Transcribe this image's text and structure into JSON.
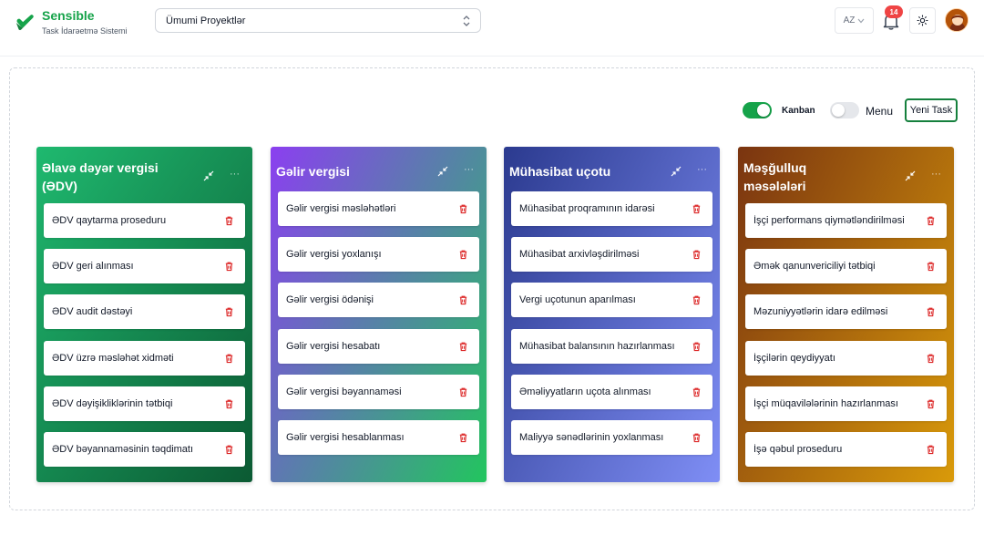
{
  "app": {
    "name": "Sensible",
    "subtitle": "Task İdarəetmə Sistemi"
  },
  "header": {
    "project_select": "Ümumi Proyektlər",
    "language": "AZ",
    "notifications_count": "14",
    "icons": {
      "logo": "check-heart-icon",
      "bell": "bell-icon",
      "theme": "sun-icon",
      "chevron": "chevron-up-down-icon",
      "user": "avatar"
    }
  },
  "toolbar": {
    "kanban_label": "Kanban",
    "kanban_on": true,
    "menu_label": "Menu",
    "menu_on": false,
    "new_task_label": "Yeni Task"
  },
  "columns": [
    {
      "title": "Əlavə dəyər vergisi (ƏDV)",
      "title_lines": [
        "Əlavə dəyər vergisi",
        "(ƏDV)"
      ],
      "colors": {
        "from": "#1fb96f",
        "to": "#0b5a33"
      },
      "cards": [
        "ƏDV qaytarma proseduru",
        "ƏDV geri alınması",
        "ƏDV audit dəstəyi",
        "ƏDV üzrə məsləhət xidməti",
        "ƏDV dəyişikliklərinin tətbiqi",
        "ƏDV bəyannaməsinin təqdimatı"
      ]
    },
    {
      "title": "Gəlir vergisi",
      "title_lines": [
        "Gəlir vergisi"
      ],
      "colors": {
        "from": "#8b3ff0",
        "to": "#22c55e"
      },
      "cards": [
        "Gəlir vergisi məsləhətləri",
        "Gəlir vergisi yoxlanışı",
        "Gəlir vergisi ödənişi",
        "Gəlir vergisi hesabatı",
        "Gəlir vergisi bəyannaməsi",
        "Gəlir vergisi hesablanması"
      ]
    },
    {
      "title": "Mühasibat uçotu",
      "title_lines": [
        "Mühasibat uçotu"
      ],
      "colors": {
        "from": "#2b3a8f",
        "to": "#7f8ef5"
      },
      "cards": [
        "Mühasibat proqramının idarəsi",
        "Mühasibat arxivləşdirilməsi",
        "Vergi uçotunun aparılması",
        "Mühasibat balansının hazırlanması",
        "Əməliyyatların uçota alınması",
        "Maliyyə sənədlərinin yoxlanması"
      ]
    },
    {
      "title": "Məşğulluq məsələləri",
      "title_lines": [
        "Məşğulluq",
        "məsələləri"
      ],
      "colors": {
        "from": "#7a3410",
        "to": "#d99a0a"
      },
      "cards": [
        "İşçi performans qiymətləndirilməsi",
        "Əmək qanunvericiliyi tətbiqi",
        "Məzuniyyətlərin idarə edilməsi",
        "İşçilərin qeydiyyatı",
        "İşçi müqavilələrinin hazırlanması",
        "İşə qəbul proseduru"
      ]
    }
  ]
}
